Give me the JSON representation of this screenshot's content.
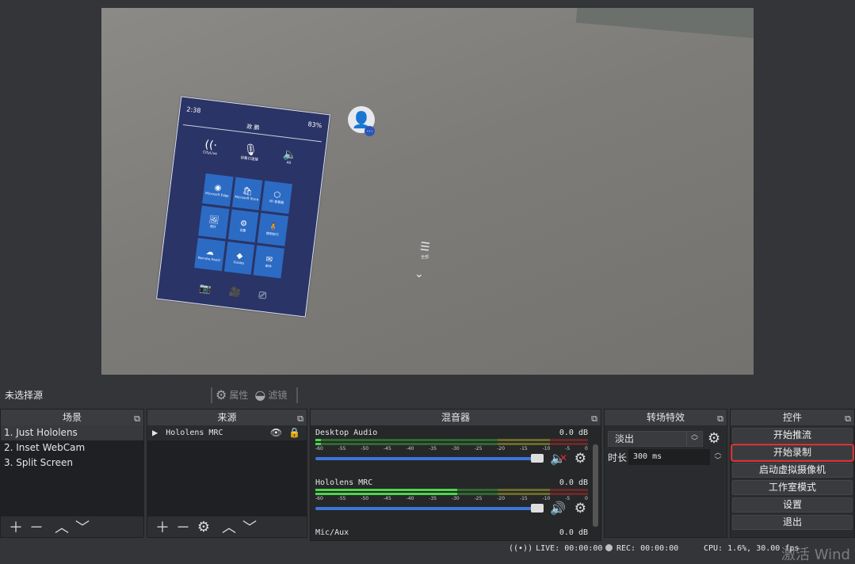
{
  "preview": {
    "menu": {
      "time": "2:38",
      "battery": "83%",
      "user": "政 鹏",
      "quick": [
        {
          "icon": "wifi-icon",
          "glyph": "((·",
          "label": "CityLive"
        },
        {
          "icon": "mic-icon",
          "glyph": "🎙",
          "label": "设备已连接"
        },
        {
          "icon": "volume-icon",
          "glyph": "🔈",
          "label": "All"
        }
      ],
      "tiles": [
        {
          "glyph": "◉",
          "label": "Microsoft Edge"
        },
        {
          "glyph": "🛍",
          "label": "Microsoft Store"
        },
        {
          "glyph": "⬡",
          "label": "3D 查看器"
        },
        {
          "glyph": "🖼",
          "label": "照片"
        },
        {
          "glyph": "⚙",
          "label": "设置"
        },
        {
          "glyph": "🧍",
          "label": "使用技巧"
        },
        {
          "glyph": "☁",
          "label": "Remote Assist"
        },
        {
          "glyph": "◆",
          "label": "Guides"
        },
        {
          "glyph": "✉",
          "label": "邮件"
        }
      ],
      "bottom": [
        "📷",
        "🎥",
        "⎚"
      ],
      "side_label": "全部"
    }
  },
  "source_bar": {
    "no_source": "未选择源",
    "properties": "属性",
    "filters": "滤镜"
  },
  "scenes": {
    "title": "场景",
    "items": [
      "1. Just Hololens",
      "2. Inset WebCam",
      "3. Split Screen"
    ]
  },
  "sources": {
    "title": "来源",
    "items": [
      "Hololens MRC"
    ]
  },
  "mixer": {
    "title": "混音器",
    "tracks": [
      {
        "name": "Desktop Audio",
        "db": "0.0 dB",
        "level": 0.02,
        "volume": 1.0,
        "muted": true
      },
      {
        "name": "Hololens MRC",
        "db": "0.0 dB",
        "level": 0.52,
        "volume": 1.0,
        "muted": false
      },
      {
        "name": "Mic/Aux",
        "db": "0.0 dB"
      }
    ],
    "ticks": [
      "-60",
      "-55",
      "-50",
      "-45",
      "-40",
      "-35",
      "-30",
      "-25",
      "-20",
      "-15",
      "-10",
      "-5",
      "0"
    ]
  },
  "transitions": {
    "title": "转场特效",
    "selected": "淡出",
    "duration_label": "时长",
    "duration_value": "300 ms"
  },
  "controls": {
    "title": "控件",
    "buttons": [
      "开始推流",
      "开始录制",
      "启动虚拟摄像机",
      "工作室模式",
      "设置",
      "退出"
    ]
  },
  "status": {
    "live": "LIVE: 00:00:00",
    "rec": "REC: 00:00:00",
    "cpu": "CPU: 1.6%, 30.00 fps"
  },
  "watermark": "激活 Wind",
  "colors": {
    "accent_blue": "#3b75d8",
    "highlight_red": "#e23030",
    "mute_red": "#e52b2b"
  }
}
